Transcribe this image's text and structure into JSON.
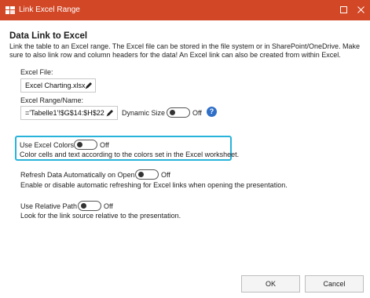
{
  "window": {
    "title": "Link Excel Range",
    "accent_color": "#d24726",
    "icons": {
      "app": "excel-link-icon",
      "maximize": "maximize-icon",
      "close": "close-icon"
    }
  },
  "intro": {
    "heading": "Data Link to Excel",
    "line1": "Link the table to an Excel range. The Excel file can be stored in the file system or in SharePoint/OneDrive. Make",
    "line2": "sure to also link row and column headers for the data!  An Excel link can also be created from within Excel."
  },
  "excel_file": {
    "label": "Excel File:",
    "value": "Excel Charting.xlsx",
    "edit_icon": "pencil-icon"
  },
  "excel_range": {
    "label": "Excel Range/Name:",
    "value": "='Tabelle1'!$G$14:$H$22",
    "edit_icon": "pencil-icon",
    "dynamic_size_label": "Dynamic Size",
    "dynamic_size_state": "Off",
    "help_glyph": "?"
  },
  "use_colors": {
    "label": "Use Excel Colors",
    "state": "Off",
    "description": "Color cells and text according to the colors set in the Excel worksheet.",
    "highlight_color": "#27b3da"
  },
  "refresh": {
    "label": "Refresh Data Automatically on Open",
    "state": "Off",
    "description": "Enable or disable automatic refreshing for Excel links when opening the presentation."
  },
  "relative_path": {
    "label": "Use Relative Path",
    "state": "Off",
    "description": "Look for the link source relative to the presentation."
  },
  "buttons": {
    "ok": "OK",
    "cancel": "Cancel"
  }
}
